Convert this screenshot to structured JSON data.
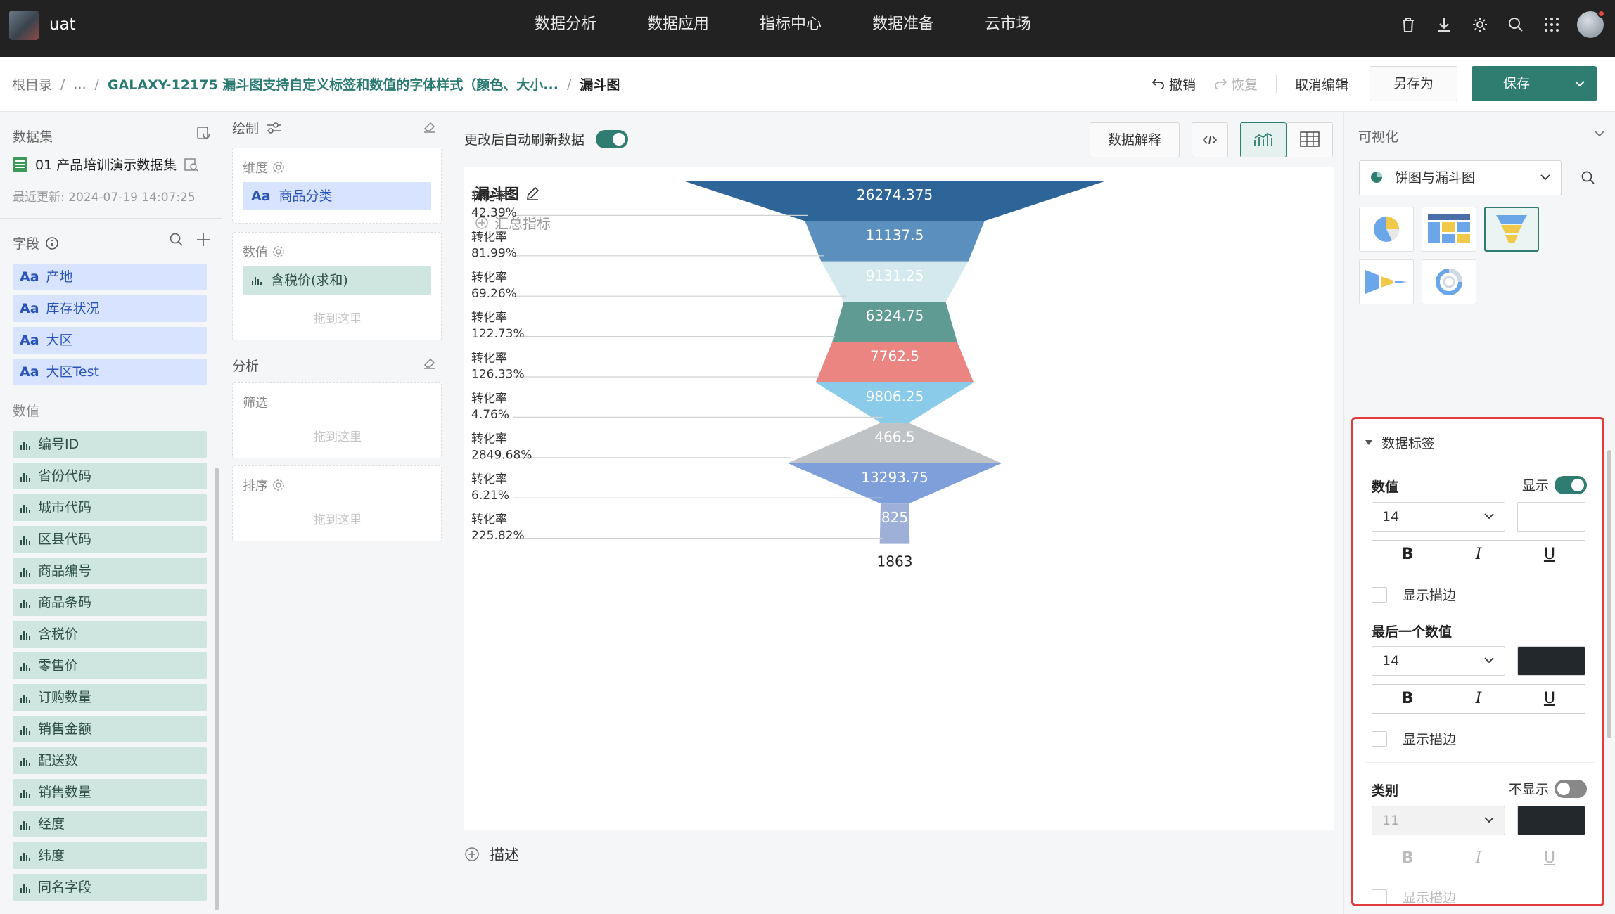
{
  "app": {
    "name": "uat"
  },
  "nav": [
    "数据分析",
    "数据应用",
    "指标中心",
    "数据准备",
    "云市场"
  ],
  "breadcrumb": {
    "root": "根目录",
    "ellipsis": "...",
    "parent": "GALAXY-12175 漏斗图支持自定义标签和数值的字体样式（颜色、大小...",
    "current": "漏斗图"
  },
  "actions": {
    "undo": "撤销",
    "redo": "恢复",
    "cancel": "取消编辑",
    "save_as": "另存为",
    "save": "保存"
  },
  "dataset": {
    "title": "数据集",
    "name": "01 产品培训演示数据集",
    "updated": "最近更新: 2024-07-19 14:07:25"
  },
  "fields": {
    "title": "字段",
    "dimensions": [
      "产地",
      "库存状况",
      "大区",
      "大区Test"
    ],
    "measures_title": "数值",
    "measures": [
      "编号ID",
      "省份代码",
      "城市代码",
      "区县代码",
      "商品编号",
      "商品条码",
      "含税价",
      "零售价",
      "订购数量",
      "销售金额",
      "配送数",
      "销售数量",
      "经度",
      "纬度",
      "同名字段"
    ]
  },
  "config": {
    "draw_title": "绘制",
    "dimension_label": "维度",
    "dimension_chip": "商品分类",
    "value_label": "数值",
    "value_chip": "含税价(求和)",
    "drop_hint": "拖到这里",
    "analysis_title": "分析",
    "filter_label": "筛选",
    "sort_label": "排序",
    "dim_prefix": "Aa"
  },
  "canvas": {
    "auto_refresh": "更改后自动刷新数据",
    "explain_btn": "数据解释",
    "chart_title": "漏斗图",
    "summary": "汇总指标",
    "describe": "描述"
  },
  "chart_data": {
    "type": "funnel",
    "values": [
      26274.375,
      11137.5,
      9131.25,
      6324.75,
      7762.5,
      9806.25,
      466.5,
      13293.75,
      825,
      1863
    ],
    "value_labels": [
      "26274.375",
      "11137.5",
      "9131.25",
      "6324.75",
      "7762.5",
      "9806.25",
      "466.5",
      "13293.75",
      "825",
      "1863"
    ],
    "conversion_label": "转化率",
    "conversion_rates": [
      "42.39%",
      "81.99%",
      "69.26%",
      "122.73%",
      "126.33%",
      "4.76%",
      "2849.68%",
      "6.21%",
      "225.82%"
    ],
    "colors": [
      "#2e6599",
      "#5b8fbd",
      "#d4e9ee",
      "#5f9b93",
      "#ea8582",
      "#89cbe9",
      "#bfc3c6",
      "#7f9fdb",
      "#9eb0d8"
    ]
  },
  "right": {
    "title": "可视化",
    "chart_category": "饼图与漏斗图",
    "label_section": "数据标签",
    "value_title": "数值",
    "show": "显示",
    "not_show": "不显示",
    "font_size_value": "14",
    "font_size_last": "14",
    "font_size_category": "11",
    "bold": "B",
    "italic": "I",
    "underline": "U",
    "show_stroke": "显示描边",
    "last_value_title": "最后一个数值",
    "category_title": "类别"
  }
}
